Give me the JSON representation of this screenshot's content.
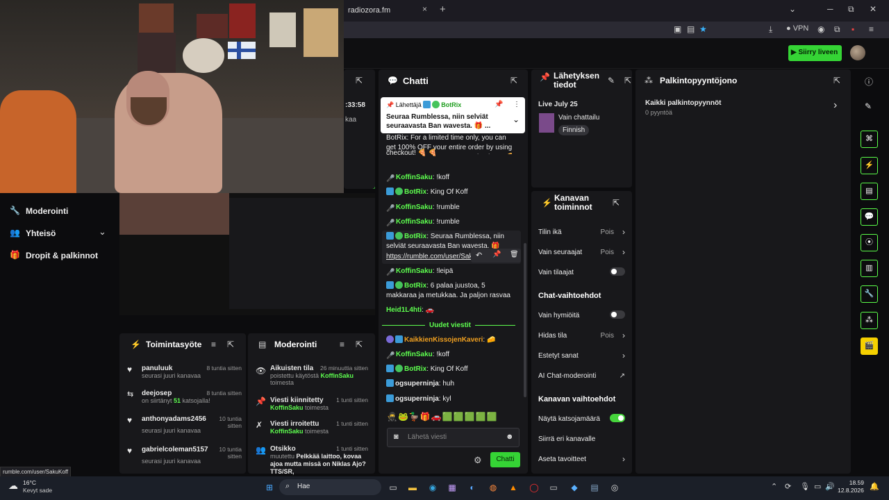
{
  "browser": {
    "tab_title": "radiozora.fm",
    "tab_close": "×",
    "new_tab": "+",
    "vpn_label": "VPN",
    "window_controls": [
      "⌄",
      "─",
      "⧉",
      "✕"
    ]
  },
  "header": {
    "go_live_label": "Siirry liveen"
  },
  "side_menu": {
    "items": [
      {
        "label": "Moderointi",
        "icon": "wrench-icon"
      },
      {
        "label": "Yhteisö",
        "icon": "community-icon"
      },
      {
        "label": "Dropit & palkinnot",
        "icon": "rewards-icon"
      }
    ]
  },
  "timer_partial": ":33:58",
  "partial_text": "kaa",
  "activity_feed": {
    "title": "Toimintasyöte",
    "items": [
      {
        "name": "panuluuk",
        "desc": "seurasi juuri kanavaa",
        "time": "8 tuntia sitten"
      },
      {
        "name": "deejosep",
        "desc_pre": "on siirtänyt ",
        "desc_num": "51",
        "desc_post": " katsojalla!",
        "time": "8 tuntia sitten"
      },
      {
        "name": "anthonyadams2456",
        "desc": "seurasi juuri kanavaa",
        "time": "10 tuntia sitten"
      },
      {
        "name": "gabrielcoleman5157",
        "desc": "seurasi juuri kanavaa",
        "time": "10 tuntia sitten"
      }
    ]
  },
  "moderation": {
    "title": "Moderointi",
    "items": [
      {
        "title": "Aikuisten tila",
        "line1": "poistettu käytöstä ",
        "user": "KoffinSaku",
        "line2": "toimesta",
        "time": "26 minuuttia sitten"
      },
      {
        "title": "Viesti kiinnitetty",
        "user": "KoffinSaku",
        "line2": " toimesta",
        "time": "1 tunti sitten"
      },
      {
        "title": "Viesti irroitettu",
        "user": "KoffinSaku",
        "line2": " toimesta",
        "time": "1 tunti sitten"
      },
      {
        "title": "Otsikko",
        "line1": "muutettu ",
        "highlight": "Pelkkää laittoo, kovaa ajoa mutta missä on Niklas Ajo? TTS/SR,",
        "time": "1 tunti sitten"
      }
    ]
  },
  "chat": {
    "title": "Chatti",
    "pinned": {
      "sender_label": "Lähettäjä",
      "sender": "BotRix",
      "text": "Seuraa Rumblessa, niin selviät seuraavasta Ban wavesta. 🎁 ..."
    },
    "partial_top": "BotRix: For a limited time only, you can get 100% OFF your entire order by using the coupon code \"PIZZA\" at checkout! 🍕 🍕",
    "messages": [
      {
        "badges": "mic",
        "user": "KoffinSaku",
        "text": "!koff"
      },
      {
        "badges": "bot",
        "user": "BotRix",
        "text": "King Of Koff"
      },
      {
        "badges": "mic",
        "user": "KoffinSaku",
        "text": "!rumble"
      },
      {
        "badges": "mic",
        "user": "KoffinSaku",
        "text": "!rumble"
      },
      {
        "badges": "bot",
        "user": "BotRix",
        "text": "Seuraa Rumblessa, niin selviät seuraavasta Ban wavesta. 🎁",
        "link": "https://rumble.com/user/SakuKoff"
      },
      {
        "badges": "mic",
        "user": "KoffinSaku",
        "text": "!leipä"
      },
      {
        "badges": "bot",
        "user": "BotRix",
        "text": "6 palaa juustoa, 5 makkaraa ja metukkaa. Ja paljon rasvaa"
      },
      {
        "badges": "none",
        "user": "Heid1L4hti",
        "text": "🚗"
      }
    ],
    "new_messages_label": "Uudet viestit",
    "new_messages": [
      {
        "badges": "sub",
        "user": "KaikkienKissojenKaveri",
        "text": "🧀"
      },
      {
        "badges": "mic",
        "user": "KoffinSaku",
        "text": "!koff"
      },
      {
        "badges": "bot",
        "user": "BotRix",
        "text": "King Of Koff"
      },
      {
        "badges": "vip",
        "user": "ogsuperninja",
        "text": "huh"
      },
      {
        "badges": "vip",
        "user": "ogsuperninja",
        "text": "kyl"
      }
    ],
    "emotes": [
      "🥷",
      "🐸",
      "🦆",
      "🎁",
      "🚗",
      "🟩",
      "🟩",
      "🟩",
      "🟩",
      "🟩"
    ],
    "input_placeholder": "Lähetä viesti",
    "send_label": "Chatti"
  },
  "stream_info": {
    "title": "Lähetyksen tiedot",
    "live_label": "Live July 25",
    "category": "Vain chattailu",
    "language": "Finnish"
  },
  "channel_actions": {
    "title": "Kanavan toiminnot",
    "rows": [
      {
        "label": "Tilin ikä",
        "value": "Pois",
        "control": "chevron"
      },
      {
        "label": "Vain seuraajat",
        "value": "Pois",
        "control": "chevron"
      },
      {
        "label": "Vain tilaajat",
        "value": "",
        "control": "toggle-off"
      }
    ],
    "chat_section": "Chat-vaihtoehdot",
    "chat_rows": [
      {
        "label": "Vain hymiöitä",
        "value": "",
        "control": "toggle-off"
      },
      {
        "label": "Hidas tila",
        "value": "Pois",
        "control": "chevron"
      },
      {
        "label": "Estetyt sanat",
        "value": "",
        "control": "chevron"
      },
      {
        "label": "AI Chat-moderointi",
        "value": "",
        "control": "external"
      }
    ],
    "channel_section": "Kanavan vaihtoehdot",
    "channel_rows": [
      {
        "label": "Näytä katsojamäärä",
        "value": "",
        "control": "toggle-on"
      },
      {
        "label": "Siirrä eri kanavalle",
        "value": "",
        "control": "none"
      },
      {
        "label": "Aseta tavoitteet",
        "value": "",
        "control": "chevron"
      }
    ]
  },
  "rewards_queue": {
    "title": "Palkintopyyntöjono",
    "item_title": "Kaikki palkintopyynnöt",
    "item_count": "0 pyyntöä"
  },
  "status_url": "rumble.com/user/SakuKoff",
  "taskbar": {
    "weather_temp": "16°C",
    "weather_desc": "Kevyt sade",
    "search_label": "Hae",
    "clock_time": "18.59",
    "clock_date": "12.8.2026"
  },
  "colors": {
    "accent": "#5eff4f",
    "bot_blue": "#3b9bd8",
    "panel": "#18181b"
  }
}
